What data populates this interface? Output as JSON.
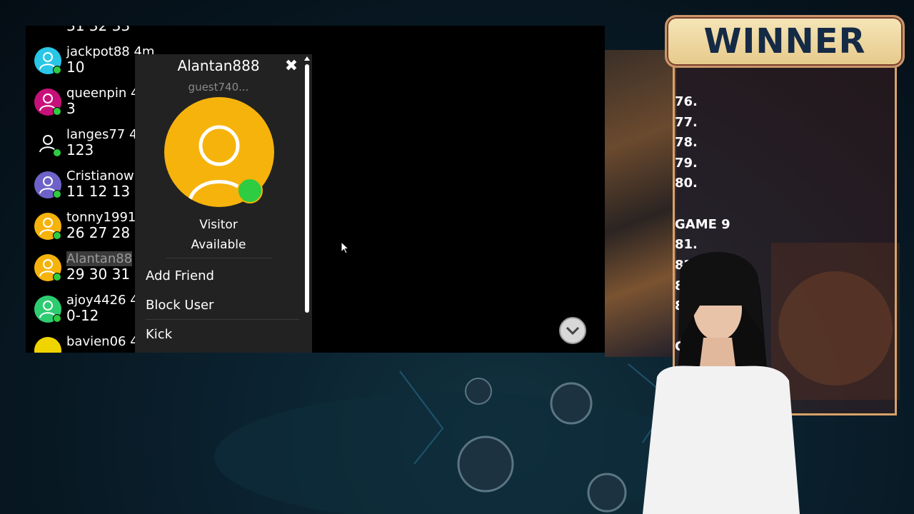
{
  "chat": {
    "top_cut_text": "31 32 33",
    "users": [
      {
        "name": "jackpot88 4m",
        "nums": "10",
        "avatar_color": "#29c6e6",
        "highlight": false
      },
      {
        "name": "queenpin 4",
        "nums": "3",
        "avatar_color": "#c8107a",
        "highlight": false
      },
      {
        "name": "langes77 4",
        "nums": "123",
        "avatar_color": "#000000",
        "highlight": false
      },
      {
        "name": "Cristianow",
        "nums": "11 12 13",
        "avatar_color": "#6e62c8",
        "highlight": false
      },
      {
        "name": "tonny1991",
        "nums": "26 27 28",
        "avatar_color": "#f6b30c",
        "highlight": false
      },
      {
        "name": "Alantan88",
        "nums": "29 30 31",
        "avatar_color": "#f6b30c",
        "highlight": true
      },
      {
        "name": "ajoy4426 4",
        "nums": "0-12",
        "avatar_color": "#2ecc71",
        "highlight": false
      },
      {
        "name": "bavien06 4",
        "nums": "",
        "avatar_color": "#f0d400",
        "highlight": false
      }
    ]
  },
  "popup": {
    "name": "Alantan888",
    "sub": "guest740...",
    "role": "Visitor",
    "status": "Available",
    "menu": [
      "Add Friend",
      "Block User",
      "Kick"
    ],
    "avatar_color": "#f6b30c",
    "online_color": "#2ecc40"
  },
  "winner": {
    "title": "WINNER",
    "lines": [
      "76.",
      "77.",
      "78.",
      "79.",
      "80.",
      "",
      "GAME 9",
      "81.",
      "82.",
      "83.",
      "84.",
      "",
      "GAM"
    ]
  }
}
